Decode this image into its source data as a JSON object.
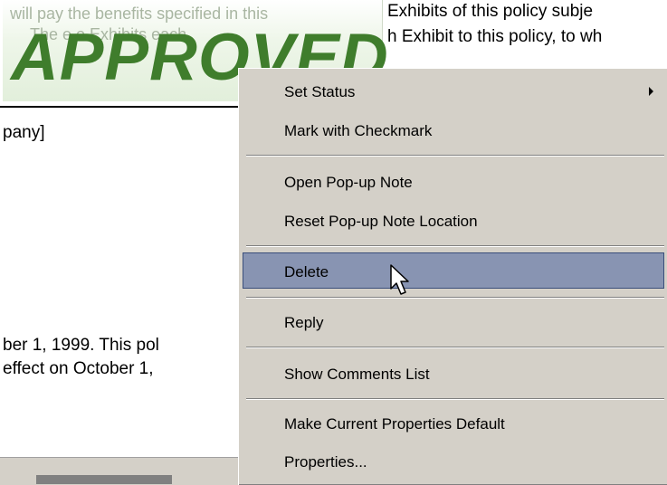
{
  "document": {
    "ghost_top": "will pay the benefits specified in this",
    "ghost_second": "The   e       o      Exhibits    each",
    "stamp": "APPROVED",
    "right_line_1": "Exhibits of this policy subje",
    "right_line_2": "h Exhibit to this policy, to wh",
    "left_company": "pany]",
    "left_line_1": "ber 1, 1999.  This pol",
    "left_line_2": "effect on October 1,"
  },
  "context_menu": {
    "items": [
      {
        "label": "Set Status",
        "has_submenu": true
      },
      {
        "label": "Mark with Checkmark"
      },
      {
        "label": "Open Pop-up Note"
      },
      {
        "label": "Reset Pop-up Note Location"
      },
      {
        "label": "Delete",
        "highlighted": true
      },
      {
        "label": "Reply"
      },
      {
        "label": "Show Comments List"
      },
      {
        "label": "Make Current Properties Default"
      },
      {
        "label": "Properties..."
      }
    ]
  }
}
